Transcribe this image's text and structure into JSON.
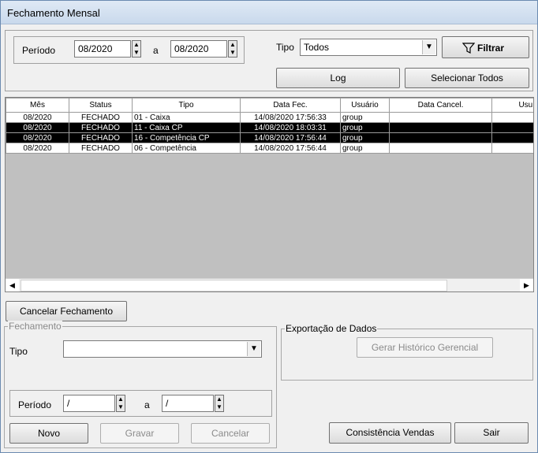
{
  "window": {
    "title": "Fechamento Mensal"
  },
  "filters": {
    "periodo_label": "Período",
    "periodo_start": "08/2020",
    "a_label": "a",
    "periodo_end": "08/2020",
    "tipo_label": "Tipo",
    "tipo_value": "Todos",
    "filtrar_label": "Filtrar",
    "log_label": "Log",
    "selecionar_todos_label": "Selecionar Todos"
  },
  "grid": {
    "columns": [
      "Mês",
      "Status",
      "Tipo",
      "Data Fec.",
      "Usuário",
      "Data Cancel.",
      "Usu. Ca"
    ],
    "rows": [
      {
        "mes": "08/2020",
        "status": "FECHADO",
        "tipo": "01 - Caixa",
        "data_fec": "14/08/2020 17:56:33",
        "usuario": "group",
        "data_cancel": "",
        "usu_cancel": "",
        "selected": false
      },
      {
        "mes": "08/2020",
        "status": "FECHADO",
        "tipo": "11 - Caixa CP",
        "data_fec": "14/08/2020 18:03:31",
        "usuario": "group",
        "data_cancel": "",
        "usu_cancel": "",
        "selected": true
      },
      {
        "mes": "08/2020",
        "status": "FECHADO",
        "tipo": "16 - Competência CP",
        "data_fec": "14/08/2020 17:56:44",
        "usuario": "group",
        "data_cancel": "",
        "usu_cancel": "",
        "selected": true
      },
      {
        "mes": "08/2020",
        "status": "FECHADO",
        "tipo": "06 - Competência",
        "data_fec": "14/08/2020 17:56:44",
        "usuario": "group",
        "data_cancel": "",
        "usu_cancel": "",
        "selected": false
      }
    ]
  },
  "actions": {
    "cancelar_fechamento_label": "Cancelar Fechamento",
    "fechamento_legend": "Fechamento",
    "fechamento_tipo_label": "Tipo",
    "fechamento_tipo_value": "",
    "fechamento_periodo_label": "Período",
    "fechamento_periodo_start": "/",
    "fechamento_a_label": "a",
    "fechamento_periodo_end": "/",
    "novo_label": "Novo",
    "gravar_label": "Gravar",
    "cancelar_label": "Cancelar",
    "exportacao_legend": "Exportação de Dados",
    "gerar_historico_label": "Gerar Histórico Gerencial",
    "consistencia_vendas_label": "Consistência Vendas",
    "sair_label": "Sair"
  }
}
